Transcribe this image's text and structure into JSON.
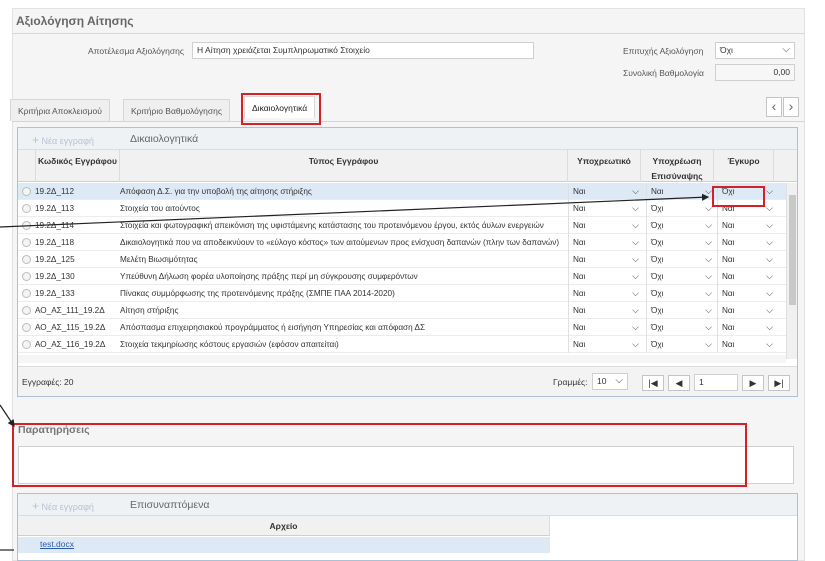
{
  "panel": {
    "title": "Αξιολόγηση Αίτησης",
    "result_label": "Αποτέλεσμα Αξιολόγησης",
    "result_value": "Η Αίτηση χρειάζεται Συμπληρωματικό Στοιχείο",
    "success_label": "Επιτυχής Αξιολόγηση",
    "success_value": "Όχι",
    "total_label": "Συνολική Βαθμολογία",
    "total_value": "0,00"
  },
  "tabs": [
    {
      "label": "Κριτήρια Αποκλεισμού"
    },
    {
      "label": "Κριτήριο Βαθμολόγησης"
    },
    {
      "label": "Δικαιολογητικά"
    }
  ],
  "grid": {
    "new_label": "Νέα εγγραφή",
    "title": "Δικαιολογητικά",
    "columns": [
      "Κωδικός Εγγράφου",
      "Τύπος Εγγράφου",
      "Υποχρεωτικό",
      "Υποχρέωση Επισύναψης",
      "Έγκυρο"
    ],
    "rows": [
      {
        "code": "19.2Δ_112",
        "type": "Απόφαση Δ.Σ. για την υποβολή της αίτησης στήριξης",
        "mandatory": "Ναι",
        "attach": "Ναι",
        "valid": "Όχι"
      },
      {
        "code": "19.2Δ_113",
        "type": "Στοιχεία του αιτούντος",
        "mandatory": "Ναι",
        "attach": "Όχι",
        "valid": "Ναι"
      },
      {
        "code": "19.2Δ_114",
        "type": "Στοιχεία και φωτογραφική απεικόνιση της υφιστάμενης κατάστασης του προτεινόμενου έργου, εκτός άυλων ενεργειών",
        "mandatory": "Ναι",
        "attach": "Όχι",
        "valid": "Ναι"
      },
      {
        "code": "19.2Δ_118",
        "type": "Δικαιολογητικά που να αποδεικνύουν το «εύλογο κόστος» των αιτούμενων προς ενίσχυση δαπανών (πλην των δαπανών)",
        "mandatory": "Ναι",
        "attach": "Όχι",
        "valid": "Ναι"
      },
      {
        "code": "19.2Δ_125",
        "type": "Μελέτη Βιωσιμότητας",
        "mandatory": "Ναι",
        "attach": "Όχι",
        "valid": "Ναι"
      },
      {
        "code": "19.2Δ_130",
        "type": "Υπεύθυνη Δήλωση φορέα υλοποίησης πράξης περί μη σύγκρουσης συμφερόντων",
        "mandatory": "Ναι",
        "attach": "Όχι",
        "valid": "Ναι"
      },
      {
        "code": "19.2Δ_133",
        "type": "Πίνακας συμμόρφωσης της προτεινόμενης πράξης (ΣΜΠΕ ΠΑΑ 2014-2020)",
        "mandatory": "Ναι",
        "attach": "Όχι",
        "valid": "Ναι"
      },
      {
        "code": "ΑΟ_ΑΣ_111_19.2Δ",
        "type": "Αίτηση στήριξης",
        "mandatory": "Ναι",
        "attach": "Όχι",
        "valid": "Ναι"
      },
      {
        "code": "ΑΟ_ΑΣ_115_19.2Δ",
        "type": "Απόσπασμα επιχειρησιακού προγράμματος ή εισήγηση Υπηρεσίας και απόφαση ΔΣ",
        "mandatory": "Ναι",
        "attach": "Όχι",
        "valid": "Ναι"
      },
      {
        "code": "ΑΟ_ΑΣ_116_19.2Δ",
        "type": "Στοιχεία τεκμηρίωσης κόστους εργασιών (εφόσον απαιτείται)",
        "mandatory": "Ναι",
        "attach": "Όχι",
        "valid": "Ναι"
      }
    ],
    "records_label": "Εγγραφές: 20",
    "lines_label": "Γραμμές:",
    "lines_value": "10",
    "page_value": "1"
  },
  "notes": {
    "title": "Παρατηρήσεις"
  },
  "attachments": {
    "new_label": "Νέα εγγραφή",
    "title": "Επισυναπτόμενα",
    "column": "Αρχείο",
    "file": "test.docx"
  },
  "icons": {
    "dropdown": "chevron-down-icon",
    "first": "first-page-icon",
    "prev": "prev-page-icon",
    "next": "next-page-icon",
    "last": "last-page-icon"
  },
  "colors": {
    "highlight": "#d61f26",
    "grid_border": "#a9c2d8",
    "selected_row": "#dde9f5"
  }
}
